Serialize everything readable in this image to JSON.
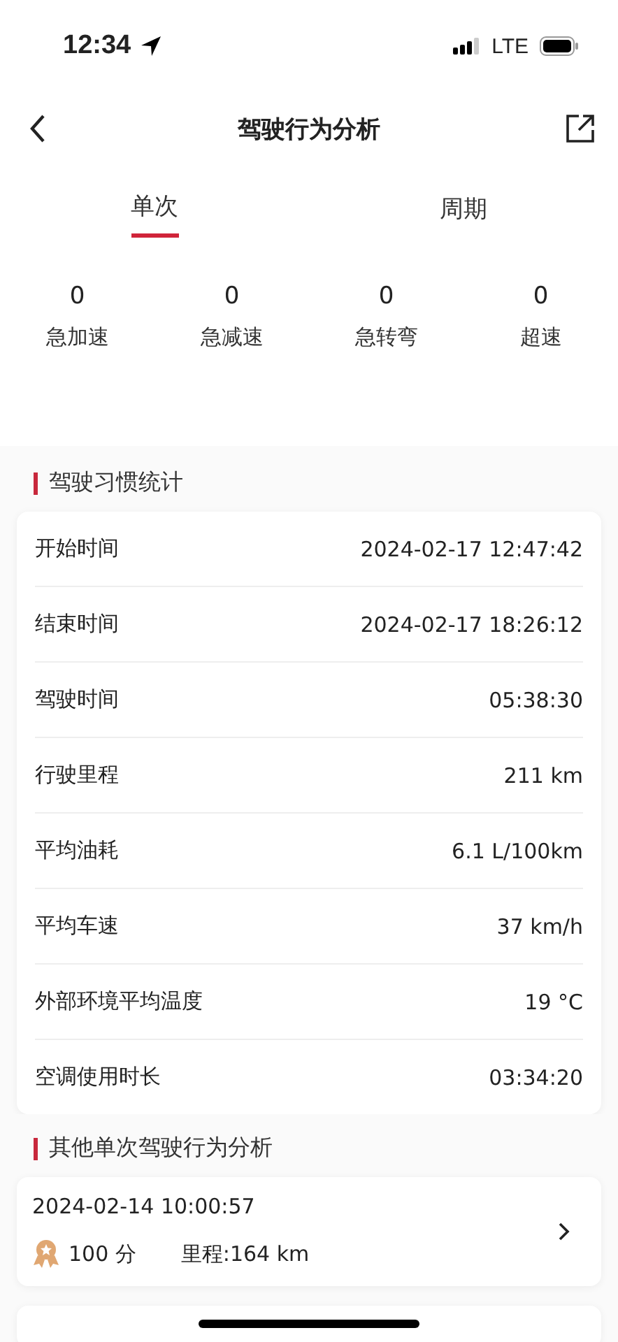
{
  "status_bar": {
    "time": "12:34",
    "network": "LTE"
  },
  "nav": {
    "title": "驾驶行为分析"
  },
  "tabs": [
    {
      "label": "单次",
      "selected": true
    },
    {
      "label": "周期",
      "selected": false
    }
  ],
  "stats": [
    {
      "value": "0",
      "label": "急加速"
    },
    {
      "value": "0",
      "label": "急减速"
    },
    {
      "value": "0",
      "label": "急转弯"
    },
    {
      "value": "0",
      "label": "超速"
    }
  ],
  "habits": {
    "title": "驾驶习惯统计",
    "rows": [
      {
        "label": "开始时间",
        "value": "2024-02-17 12:47:42"
      },
      {
        "label": "结束时间",
        "value": "2024-02-17 18:26:12"
      },
      {
        "label": "驾驶时间",
        "value": "05:38:30"
      },
      {
        "label": "行驶里程",
        "value": "211 km"
      },
      {
        "label": "平均油耗",
        "value": "6.1 L/100km"
      },
      {
        "label": "平均车速",
        "value": "37 km/h"
      },
      {
        "label": "外部环境平均温度",
        "value": "19 °C"
      },
      {
        "label": "空调使用时长",
        "value": "03:34:20"
      }
    ]
  },
  "others": {
    "title": "其他单次驾驶行为分析",
    "records": [
      {
        "time": "2024-02-14 10:00:57",
        "score": "100 分",
        "mileage": "里程:164 km"
      }
    ]
  }
}
